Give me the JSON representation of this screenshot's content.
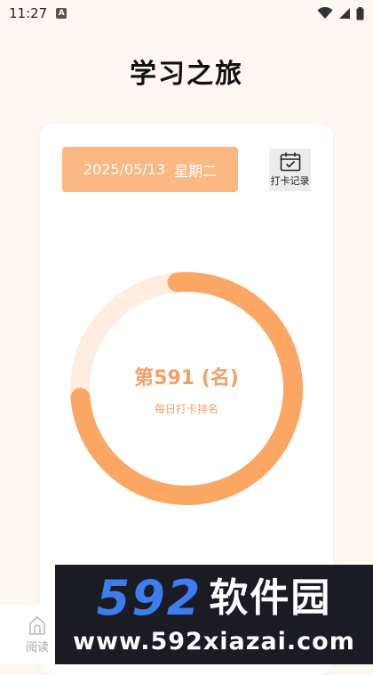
{
  "status_bar": {
    "time": "11:27",
    "notification_icon": "A"
  },
  "header": {
    "title": "学习之旅"
  },
  "card": {
    "date": "2025/05/13",
    "weekday": "星期二",
    "record_label": "打卡记录",
    "rank_text": "第591 (名)",
    "rank_subtitle": "每日打卡排名",
    "progress": 0.75
  },
  "tabbar": {
    "read_label": "阅读"
  },
  "watermark": {
    "number": "592",
    "name": "软件园",
    "url": "www.592xiazai.com"
  },
  "colors": {
    "accent": "#fcb883",
    "ring_fill": "#fba763",
    "ring_track": "#fdece0",
    "background": "#fdf6f1"
  }
}
